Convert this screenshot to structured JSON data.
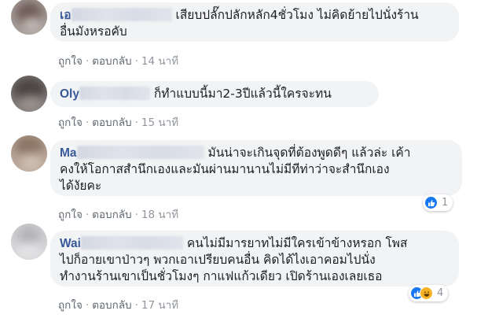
{
  "comments": [
    {
      "author": "เอ",
      "text_lines": [
        "เสียบปลั๊กปลักหลัก4ชั่วโมง ไม่คิดย้ายไปนั่งร้าน",
        "อื่นมังหรอคับ"
      ],
      "actions": {
        "like": "ถูกใจ",
        "reply": "ตอบกลับ",
        "time": "14 นาที"
      }
    },
    {
      "author": "Oly",
      "text_lines": [
        "ก็ทำแบบนี้มา2-3ปีแล้วนี้ใครจะทน"
      ],
      "actions": {
        "like": "ถูกใจ",
        "reply": "ตอบกลับ",
        "time": "15 นาที"
      }
    },
    {
      "author": "Ma",
      "text_lines": [
        "มันน่าจะเกินจุดที่ต้องพูดดีๆ แล้วล่ะ เค้า",
        "คงให้โอกาสสำนึกเองและมันผ่านมานานไม่มีทีท่าว่าจะสำนึกเอง",
        "ได้งัยคะ"
      ],
      "actions": {
        "like": "ถูกใจ",
        "reply": "ตอบกลับ",
        "time": "18 นาที"
      },
      "reactions": {
        "count": "1",
        "icons": [
          "like-icon"
        ]
      }
    },
    {
      "author": "Wai",
      "text_lines": [
        "คนไม่มีมารยาทไม่มีใครเข้าข้างหรอก โพส",
        "ไปก็อายเขาป่าวๆ พวกเอาเปรียบคนอื่น คิดได้ไงเอาคอมไปนั่ง",
        "ทำงานร้านเขาเป็นชั่วโมงๆ กาแฟแก้วเดียว เปิดร้านเองเลยเธอ"
      ],
      "actions": {
        "like": "ถูกใจ",
        "reply": "ตอบกลับ",
        "time": "17 นาที"
      },
      "reactions": {
        "count": "4",
        "icons": [
          "like-icon",
          "laugh-icon"
        ]
      }
    }
  ],
  "colors": {
    "author": "#385898",
    "bubble": "#f2f3f5",
    "meta": "#606770",
    "like": "#1877f2",
    "laugh": "#f7b125"
  }
}
